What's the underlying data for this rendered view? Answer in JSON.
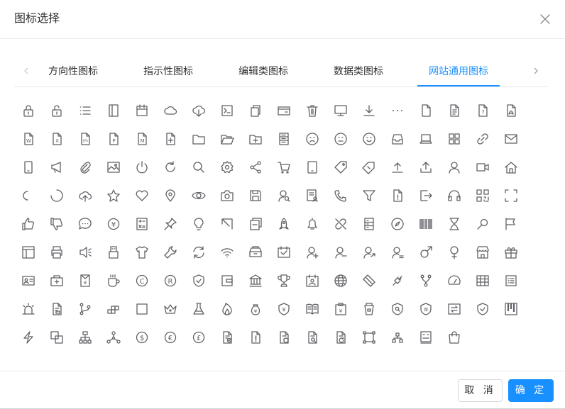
{
  "dialog": {
    "title": "图标选择",
    "close_icon": "close-icon"
  },
  "tabs": {
    "prev_icon": "chevron-left-icon",
    "next_icon": "chevron-right-icon",
    "items": [
      {
        "label": "方向性图标",
        "active": false
      },
      {
        "label": "指示性图标",
        "active": false
      },
      {
        "label": "编辑类图标",
        "active": false
      },
      {
        "label": "数据类图标",
        "active": false
      },
      {
        "label": "网站通用图标",
        "active": true
      }
    ],
    "active_color": "#1890ff"
  },
  "icons": [
    "lock",
    "unlock",
    "menu",
    "notebook",
    "date",
    "cloudy",
    "download-cloud",
    "terminal",
    "copy-document",
    "wallet",
    "delete",
    "monitor",
    "download",
    "more",
    "document",
    "tickets",
    "document-question",
    "document-pdf",
    "word-document",
    "excel-document",
    "jpg-document",
    "ppt-document",
    "markdown-document",
    "document-add",
    "folder",
    "folder-opened",
    "folder-add",
    "storage",
    "sad-face",
    "neutral-face",
    "smile-face",
    "inbox",
    "laptop",
    "grid",
    "link",
    "message",
    "mobile-phone",
    "megaphone",
    "paperclip",
    "picture",
    "switch-button",
    "refresh-right",
    "search",
    "setting",
    "share",
    "shopping-cart",
    "tablet",
    "price-tag",
    "discount",
    "upload-bottom",
    "upload",
    "user",
    "video-camera",
    "house",
    "loading-small",
    "loading",
    "upload-cloud",
    "star",
    "heart",
    "location",
    "view",
    "camera",
    "save",
    "user-search",
    "reading",
    "phone",
    "filter",
    "alarm-document",
    "exit",
    "headset",
    "qrcode",
    "full-screen",
    "thumbs-up",
    "thumbs-down",
    "chat",
    "yen-coin",
    "calculator",
    "pin",
    "lightbulb",
    "top-left-arrow",
    "minimize",
    "rocket",
    "bell",
    "unlink",
    "server",
    "compass",
    "barcode",
    "hourglass",
    "magic-stick",
    "flag",
    "layout",
    "printer",
    "volume",
    "usb",
    "t-shirt",
    "wrench",
    "refresh",
    "wifi",
    "cashier",
    "schedule",
    "add-user",
    "remove-user",
    "user-share",
    "user-more",
    "male",
    "female",
    "store",
    "gift",
    "id-card",
    "first-aid",
    "money-envelope",
    "coffee",
    "copyright",
    "registered",
    "shield-check",
    "wallet-card",
    "bank",
    "trophy",
    "badge-card",
    "globe",
    "ticket",
    "plug",
    "fork",
    "speedometer",
    "table",
    "list",
    "siren",
    "document-print",
    "branch",
    "blocks",
    "square",
    "crown",
    "flask",
    "fire",
    "yen-bag",
    "yen-shield",
    "book-open",
    "clipboard-money",
    "cup",
    "shield-search",
    "certificate",
    "exchange",
    "check-shield",
    "kanban",
    "lightning",
    "merge-squares",
    "org-chart",
    "nodes",
    "dollar-coin",
    "euro-coin",
    "pound-coin",
    "document-approve",
    "document-warning",
    "document-shield",
    "document-search",
    "document-refresh",
    "selection",
    "hierarchy",
    "ai-screen",
    "shopping-bag"
  ],
  "footer": {
    "cancel_label": "取 消",
    "ok_label": "确 定"
  }
}
